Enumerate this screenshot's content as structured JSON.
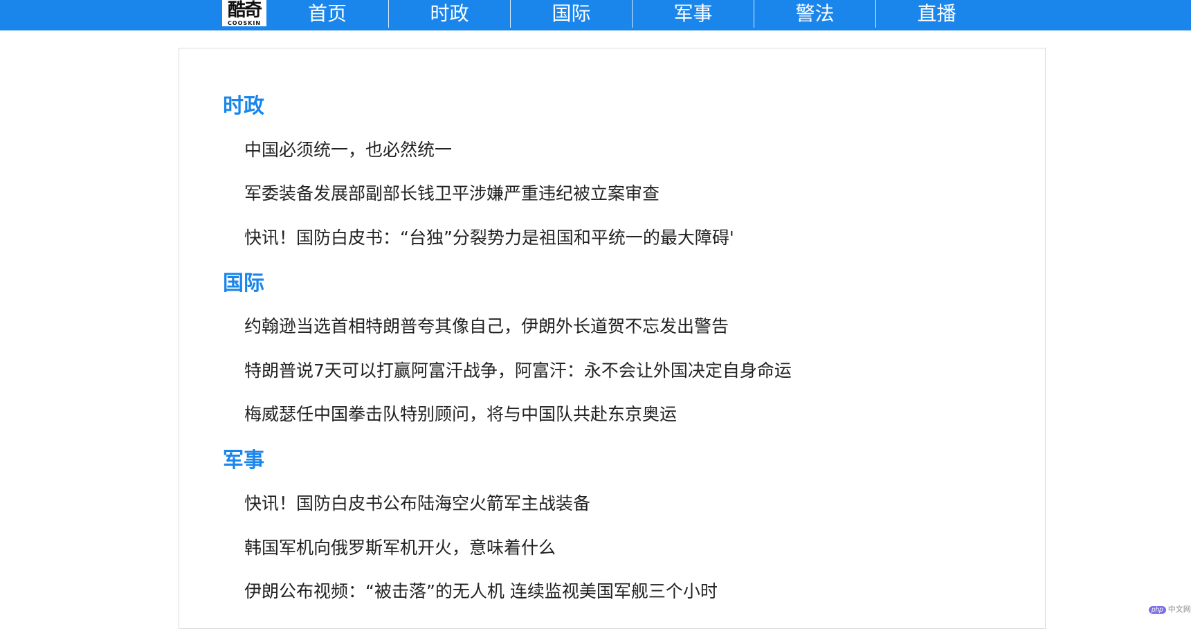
{
  "logo": {
    "main": "酷奇",
    "sub": "COOSKIN"
  },
  "nav": {
    "items": [
      {
        "label": "首页"
      },
      {
        "label": "时政"
      },
      {
        "label": "国际"
      },
      {
        "label": "军事"
      },
      {
        "label": "警法"
      },
      {
        "label": "直播"
      }
    ]
  },
  "sections": [
    {
      "title": "时政",
      "articles": [
        "中国必须统一，也必然统一",
        "军委装备发展部副部长钱卫平涉嫌严重违纪被立案审查",
        "快讯！国防白皮书：“台独”分裂势力是祖国和平统一的最大障碍'"
      ]
    },
    {
      "title": "国际",
      "articles": [
        "约翰逊当选首相特朗普夸其像自己，伊朗外长道贺不忘发出警告",
        "特朗普说7天可以打赢阿富汗战争，阿富汗：永不会让外国决定自身命运",
        "梅威瑟任中国拳击队特别顾问，将与中国队共赴东京奥运"
      ]
    },
    {
      "title": "军事",
      "articles": [
        "快讯！国防白皮书公布陆海空火箭军主战装备",
        "韩国军机向俄罗斯军机开火，意味着什么",
        "伊朗公布视频：“被击落”的无人机 连续监视美国军舰三个小时"
      ]
    }
  ],
  "watermark": {
    "badge": "php",
    "text": "中文网"
  },
  "colors": {
    "accent": "#1a86ec"
  }
}
